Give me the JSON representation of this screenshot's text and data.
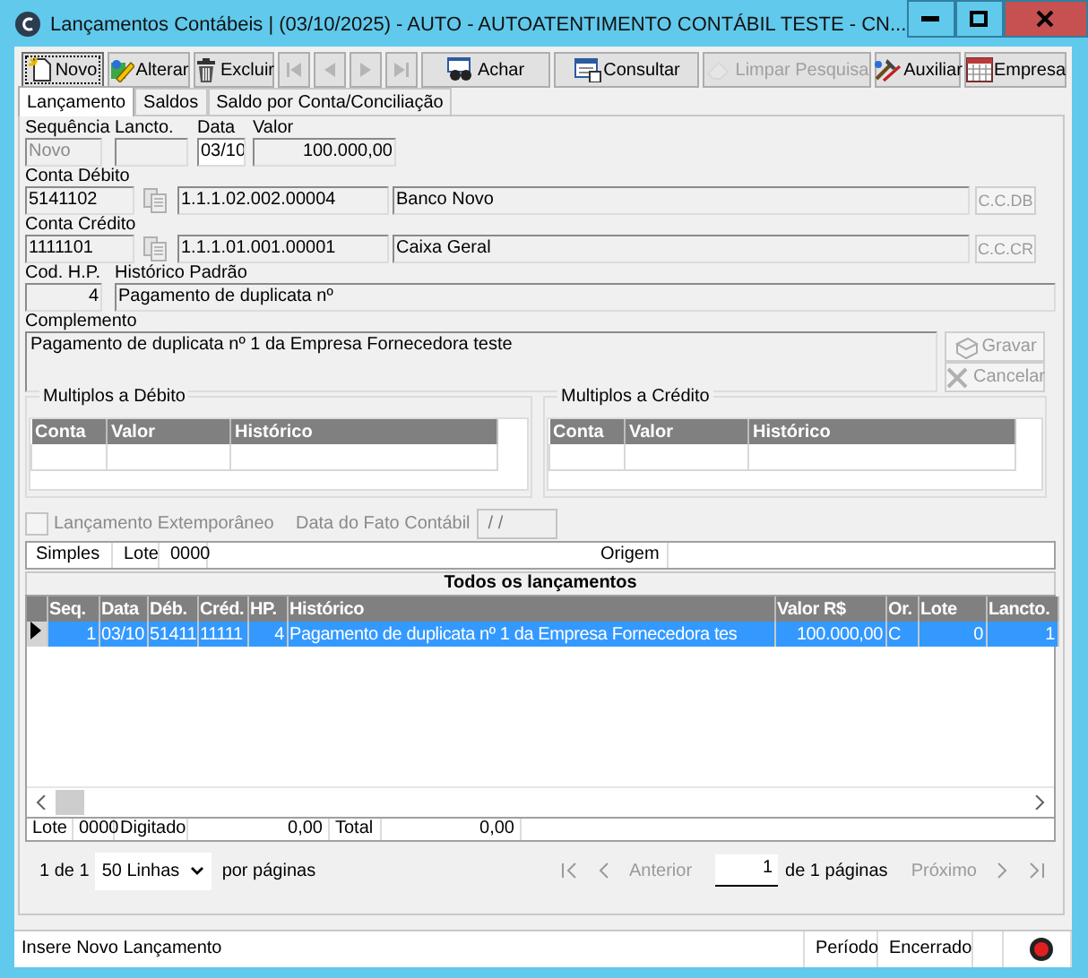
{
  "window": {
    "title": "Lançamentos Contábeis | (03/10/2025) - AUTO - AUTOATENTIMENTO CONTÁBIL TESTE  - CN..."
  },
  "toolbar": [
    {
      "kind": "new",
      "label": "Novo",
      "disabled": false,
      "focused": true
    },
    {
      "kind": "edit",
      "label": "Alterar",
      "disabled": false,
      "focused": false
    },
    {
      "kind": "delete",
      "label": "Excluir",
      "disabled": false,
      "focused": false
    },
    {
      "kind": "first",
      "disabled": true,
      "focused": false
    },
    {
      "kind": "prev",
      "disabled": true,
      "focused": false
    },
    {
      "kind": "next",
      "disabled": true,
      "focused": false
    },
    {
      "kind": "last",
      "disabled": true,
      "focused": false
    },
    {
      "kind": "find",
      "label": "Achar",
      "disabled": false,
      "focused": false
    },
    {
      "kind": "query",
      "label": "Consultar",
      "disabled": false,
      "focused": false
    },
    {
      "kind": "clear",
      "label": "Limpar Pesquisa",
      "disabled": true,
      "focused": false
    },
    {
      "kind": "tools",
      "label": "Auxiliar",
      "disabled": false,
      "focused": false
    },
    {
      "kind": "company",
      "label": "Empresa",
      "disabled": false,
      "focused": false
    }
  ],
  "tabs": [
    {
      "label": "Lançamento",
      "selected": true
    },
    {
      "label": "Saldos",
      "selected": false
    },
    {
      "label": "Saldo por Conta/Conciliação",
      "selected": false
    }
  ],
  "entry": {
    "sequence": {
      "label": "Sequência",
      "placeholder": "Novo"
    },
    "lancto": {
      "label": "Lancto."
    },
    "date": {
      "label": "Data",
      "value": "03/10"
    },
    "amount": {
      "label": "Valor",
      "value": "100.000,00"
    }
  },
  "accounts": [
    {
      "label": "Conta Débito",
      "code": "5141102",
      "classification": "1.1.1.02.002.00004",
      "name": "Banco Novo",
      "button": "C.C.DB",
      "button_disabled": true
    },
    {
      "label": "Conta Crédito",
      "code": "1111101",
      "classification": "1.1.1.01.001.00001",
      "name": "Caixa Geral",
      "button": "C.C.CR",
      "button_disabled": true
    }
  ],
  "history": {
    "code_label": "Cod. H.P.",
    "code": "4",
    "label": "Histórico Padrão",
    "text": "Pagamento de duplicata nº"
  },
  "complement": {
    "label": "Complemento",
    "value": "Pagamento de duplicata nº 1 da Empresa Fornecedora teste"
  },
  "actions": [
    {
      "kind": "save",
      "label": "Gravar",
      "disabled": true
    },
    {
      "kind": "cancel",
      "label": "Cancelar",
      "disabled": true
    }
  ],
  "multiples": [
    {
      "title": "Multiplos a Débito",
      "columns": [
        "Conta",
        "Valor",
        "Histórico"
      ]
    },
    {
      "title": "Multiplos a Crédito",
      "columns": [
        "Conta",
        "Valor",
        "Histórico"
      ]
    }
  ],
  "extemporaneous": {
    "label": "Lançamento Extemporâneo",
    "checked": false,
    "disabled": true,
    "date_label": "Data do Fato Contábil",
    "date_value": "/ /"
  },
  "info_bar": [
    "Simples",
    "Lote",
    "0000",
    "Origem"
  ],
  "grid": {
    "title": "Todos os lançamentos",
    "columns": [
      "Seq.",
      "Data",
      "Déb.",
      "Créd.",
      "HP.",
      "Histórico",
      "Valor R$",
      "Or.",
      "Lote",
      "Lancto."
    ],
    "rows": [
      {
        "selected": true,
        "cells": [
          "1",
          "03/10",
          "51411",
          "11111",
          "4",
          "Pagamento de duplicata nº 1 da Empresa Fornecedora tes",
          "100.000,00",
          "C",
          "0",
          "1"
        ]
      }
    ]
  },
  "totals": [
    "Lote",
    "0000",
    "Digitado",
    "0,00",
    "Total",
    "0,00"
  ],
  "pager": {
    "summary": "1 de 1",
    "page_size": "50 Linhas",
    "per_page_label": "por páginas",
    "before": [
      {
        "kind": "first",
        "disabled": true
      },
      {
        "kind": "prev",
        "label": "Anterior",
        "disabled": true
      }
    ],
    "page": "1",
    "pages_label": "de 1 páginas",
    "after": [
      {
        "kind": "next",
        "label": "Próximo",
        "disabled": true
      },
      {
        "kind": "last",
        "disabled": true
      }
    ]
  },
  "status_bar": [
    "Insere Novo Lançamento",
    "Período",
    "Encerrado"
  ]
}
